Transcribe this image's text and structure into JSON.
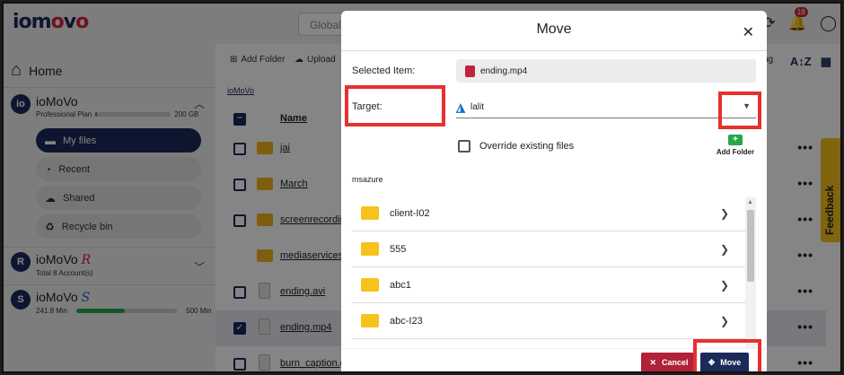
{
  "app": {
    "logo_text": "iomovo"
  },
  "header": {
    "search_placeholder": "Global"
  },
  "notifications": {
    "count": "18"
  },
  "sidebar": {
    "home_label": "Home",
    "accounts": [
      {
        "name": "ioMoVo",
        "plan": "Professional Plan",
        "storage": "200 GB",
        "usage_fraction": 0.0
      },
      {
        "name": "ioMoVo",
        "suffix": "R",
        "sub": "Total 8 Account(s)"
      },
      {
        "name": "ioMoVo",
        "suffix": "S",
        "sub_left": "241.8 Min",
        "sub_right": "500 Min",
        "usage_fraction": 0.48
      }
    ],
    "nav": [
      {
        "label": "My files",
        "active": true
      },
      {
        "label": "Recent"
      },
      {
        "label": "Shared"
      },
      {
        "label": "Recycle bin"
      }
    ]
  },
  "main": {
    "toolbar": {
      "add_folder": "Add Folder",
      "upload": "Upload",
      "sort_label": "ng"
    },
    "breadcrumb": "ioMoVo",
    "column_name": "Name",
    "rows": [
      {
        "name": "jai",
        "type": "folder"
      },
      {
        "name": "March",
        "type": "folder"
      },
      {
        "name": "screenrecording",
        "type": "folder"
      },
      {
        "name": "mediaservices",
        "type": "folder"
      },
      {
        "name": "ending.avi",
        "type": "video"
      },
      {
        "name": "ending.mp4",
        "type": "video",
        "selected": true
      },
      {
        "name": "burn_caption.g",
        "type": "video"
      }
    ]
  },
  "feedback": {
    "label": "Feedback"
  },
  "modal": {
    "title": "Move",
    "selected_item_label": "Selected Item:",
    "selected_item_value": "ending.mp4",
    "target_label": "Target:",
    "target_value": "lalit",
    "override_label": "Override existing files",
    "add_folder_label": "Add Folder",
    "section_label": "msazure",
    "folders": [
      "client-I02",
      "555",
      "abc1",
      "abc-I23",
      ""
    ],
    "cancel_label": "Cancel",
    "move_label": "Move"
  },
  "colors": {
    "brand_navy": "#1c2a5a",
    "cancel_red": "#b0213a",
    "highlight_red": "#e8302e",
    "folder_yellow": "#f6c21c"
  }
}
